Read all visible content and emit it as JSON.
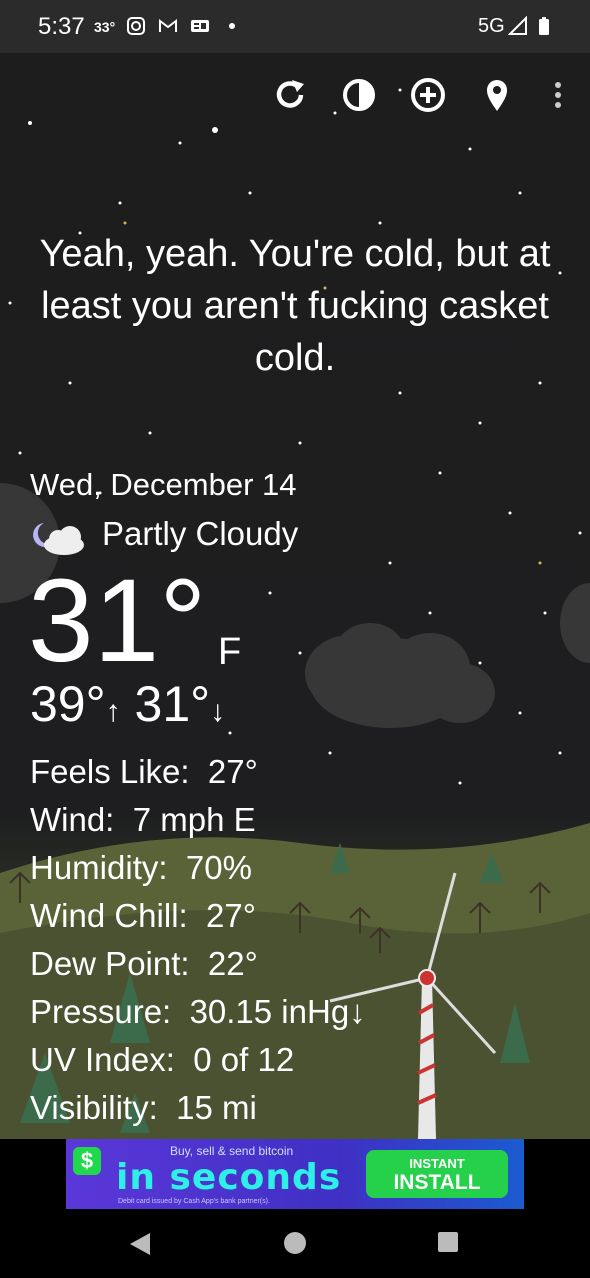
{
  "status_bar": {
    "time": "5:37",
    "temp": "33°",
    "network": "5G",
    "icons": [
      "instagram-icon",
      "gmail-icon",
      "news-icon",
      "dot-icon",
      "signal-icon",
      "battery-icon"
    ]
  },
  "toolbar": {
    "icons": [
      "refresh-icon",
      "theme-icon",
      "add-location-icon",
      "location-pin-icon",
      "more-icon"
    ]
  },
  "quote": "Yeah, yeah. You're cold, but at least you aren't fucking casket cold.",
  "weather": {
    "date": "Wed, December 14",
    "condition": "Partly Cloudy",
    "condition_icon": "partly-cloudy-night-icon",
    "temperature": "31°",
    "unit": "F",
    "high": "39°",
    "low": "31°"
  },
  "details": [
    {
      "label": "Feels Like:",
      "value": "27°"
    },
    {
      "label": "Wind:",
      "value": "7 mph E"
    },
    {
      "label": "Humidity:",
      "value": "70%"
    },
    {
      "label": "Wind Chill:",
      "value": "27°"
    },
    {
      "label": "Dew Point:",
      "value": "22°"
    },
    {
      "label": "Pressure:",
      "value": "30.15 inHg↓"
    },
    {
      "label": "UV Index:",
      "value": "0 of 12"
    },
    {
      "label": "Visibility:",
      "value": "15 mi"
    }
  ],
  "ad": {
    "small_text": "Buy, sell & send bitcoin",
    "big_text": "in seconds",
    "tiny_text": "Debit card issued by Cash App's bank partner(s).",
    "button_line1": "INSTANT",
    "button_line2": "INSTALL",
    "logo": "$"
  },
  "nav": [
    "back-icon",
    "home-icon",
    "recents-icon"
  ]
}
